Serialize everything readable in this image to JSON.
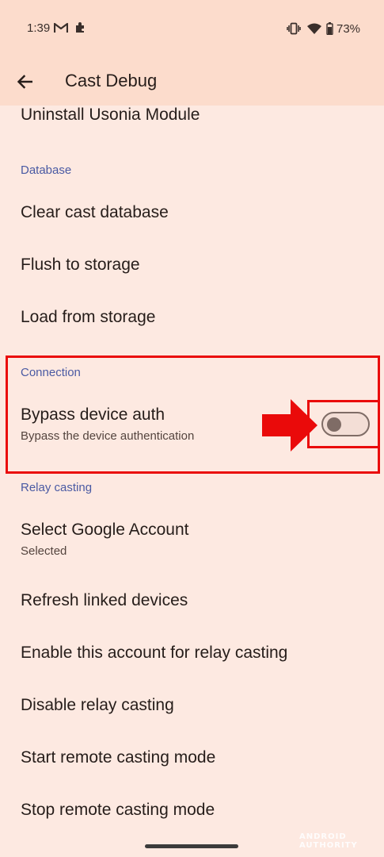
{
  "status_bar": {
    "time": "1:39",
    "battery_percent": "73%",
    "icons": [
      "gmail-icon",
      "puzzle-icon",
      "vibrate-icon",
      "wifi-icon",
      "battery-icon"
    ]
  },
  "app_bar": {
    "title": "Cast Debug",
    "back_icon": "arrow-back-icon"
  },
  "list": {
    "top_item": "Uninstall Usonia Module",
    "database_section": {
      "header": "Database",
      "items": [
        "Clear cast database",
        "Flush to storage",
        "Load from storage"
      ]
    },
    "connection_section": {
      "header": "Connection",
      "bypass": {
        "title": "Bypass device auth",
        "summary": "Bypass the device authentication",
        "enabled": false
      }
    },
    "relay_section": {
      "header": "Relay casting",
      "select_account": {
        "title": "Select Google Account",
        "summary": "Selected"
      },
      "items": [
        "Refresh linked devices",
        "Enable this account for relay casting",
        "Disable relay casting",
        "Start remote casting mode",
        "Stop remote casting mode"
      ]
    }
  },
  "watermark": "ANDROID AUTHORITY",
  "colors": {
    "background": "#FDE9E1",
    "app_bar": "#FCDCCC",
    "section_header": "#4A5AA3",
    "highlight": "#EA0A0A",
    "toggle_outline": "#7F6C66"
  }
}
